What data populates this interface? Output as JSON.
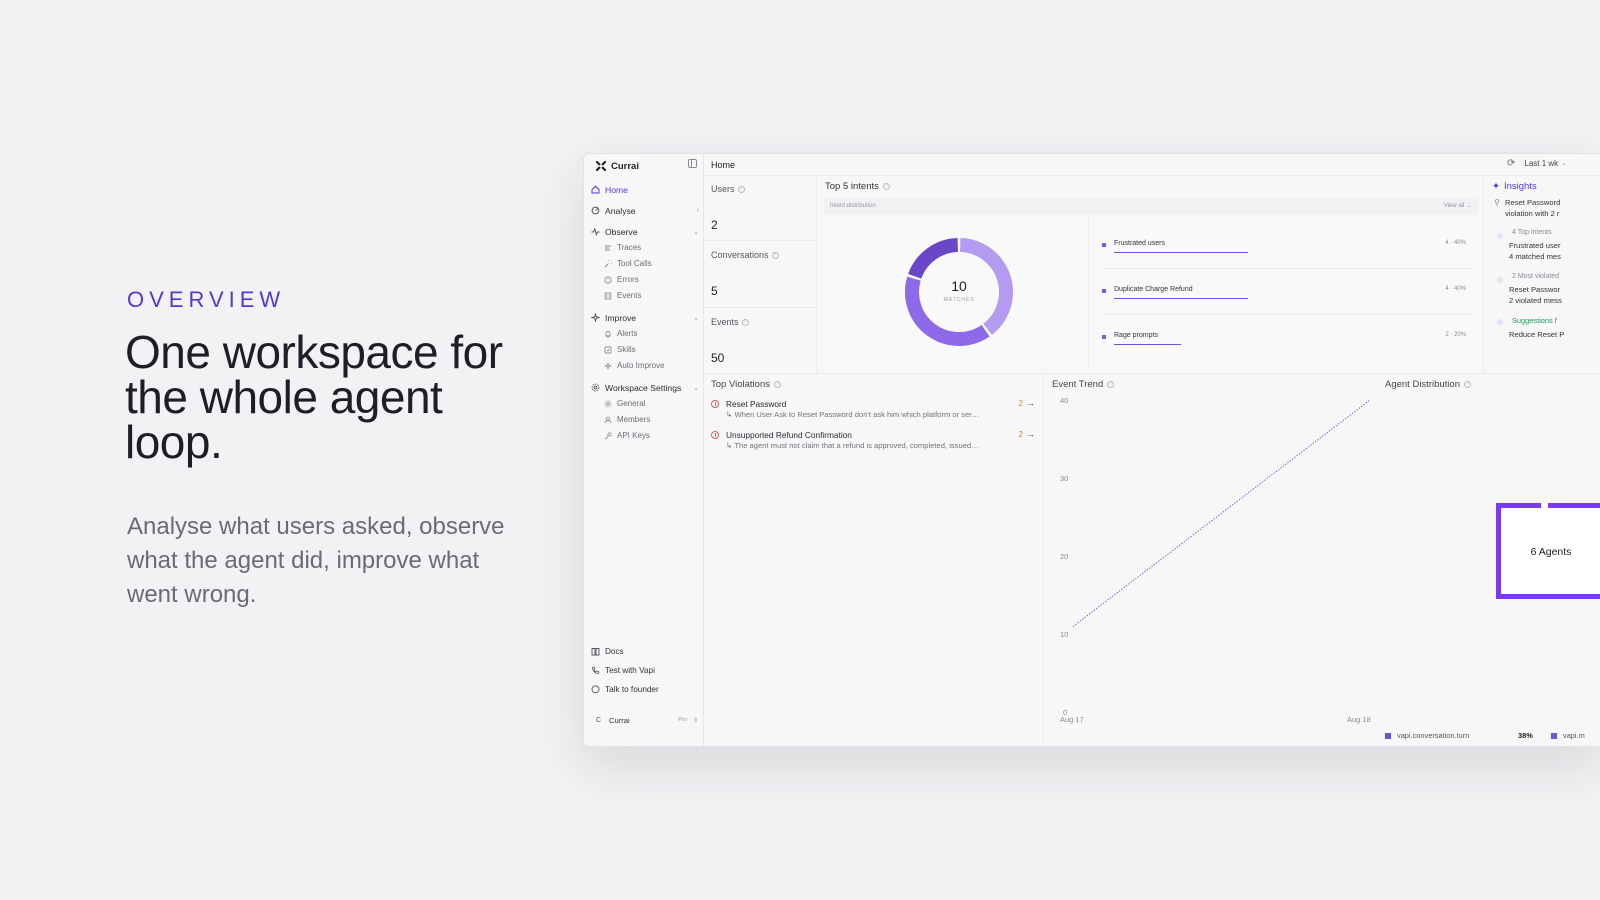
{
  "hero": {
    "eyebrow": "OVERVIEW",
    "headline_line1": "One workspace for",
    "headline_line2": "the whole agent",
    "headline_line3": "loop.",
    "subline": "Analyse what users asked, observe what the agent did, improve what went wrong."
  },
  "app": {
    "brand": "Currai",
    "page_title": "Home",
    "date_range": "Last 1 wk",
    "sidebar": {
      "home": "Home",
      "analyse": "Analyse",
      "observe": "Observe",
      "observe_items": [
        "Traces",
        "Tool Calls",
        "Errors",
        "Events"
      ],
      "improve": "Improve",
      "improve_items": [
        "Alerts",
        "Skills",
        "Auto Improve"
      ],
      "workspace_settings": "Workspace Settings",
      "workspace_items": [
        "General",
        "Members",
        "API Keys"
      ],
      "footer": [
        "Docs",
        "Test with Vapi",
        "Talk to founder"
      ],
      "workspace": {
        "avatar": "C",
        "name": "Currai",
        "plan": "Pro"
      }
    },
    "kpis": [
      {
        "label": "Users",
        "value": "2"
      },
      {
        "label": "Conversations",
        "value": "5"
      },
      {
        "label": "Events",
        "value": "50"
      }
    ],
    "intents": {
      "title": "Top 5 intents",
      "subtitle": "Intent distribution",
      "view_all": "View all →",
      "total": "10",
      "total_caption": "MATCHES",
      "items": [
        {
          "name": "Frustrated users",
          "value": "4 · 40%",
          "share": 0.4
        },
        {
          "name": "Duplicate Charge Refund",
          "value": "4 · 40%",
          "share": 0.4
        },
        {
          "name": "Rage prompts",
          "value": "2 · 20%",
          "share": 0.2
        }
      ]
    },
    "insights": {
      "title": "Insights",
      "lead_1": "Reset Password",
      "lead_2": "violation with 2 r",
      "g1_meta": "4 Top intents",
      "g1_text_1": "Frustrated user",
      "g1_text_2": "4 matched mes",
      "g2_meta": "2 Most violated",
      "g2_text_1": "Reset Passwor",
      "g2_text_2": "2 violated mess",
      "g3_meta": "Suggestions f",
      "g3_text_1": "Reduce Reset P"
    },
    "violations": {
      "title": "Top Violations",
      "items": [
        {
          "title": "Reset Password",
          "desc": "↳  When User Ask to Reset Password don't ask him which platform or ser…",
          "count": "2",
          "arrow": "→"
        },
        {
          "title": "Unsupported Refund Confirmation",
          "desc": "↳  The agent must not claim that a refund is approved, completed, issued…",
          "count": "2",
          "arrow": "→"
        }
      ]
    },
    "event_trend": {
      "title": "Event Trend",
      "y_ticks": [
        "40",
        "30",
        "20",
        "10",
        "0"
      ],
      "x_ticks": [
        "Aug 17",
        "Aug 18"
      ]
    },
    "agent_distribution": {
      "title": "Agent Distribution",
      "center_label": "6 Agents",
      "legend_1": "vapi.conversation.turn",
      "legend_1_pct": "38%",
      "legend_2": "vapi.m"
    }
  },
  "chart_data": {
    "type": "line",
    "title": "Event Trend",
    "x": [
      "Aug 17",
      "Aug 18"
    ],
    "series": [
      {
        "values": [
          10,
          40
        ]
      }
    ],
    "ylim": [
      0,
      40
    ],
    "y_ticks": [
      0,
      10,
      20,
      30,
      40
    ],
    "grid": false
  },
  "colors": {
    "accent": "#4b3ad6",
    "chart_purple": "#7a5ae0",
    "violation_red": "#e25b5b",
    "count_orange": "#d08a18",
    "suggestion_green": "#1d9a5f"
  }
}
